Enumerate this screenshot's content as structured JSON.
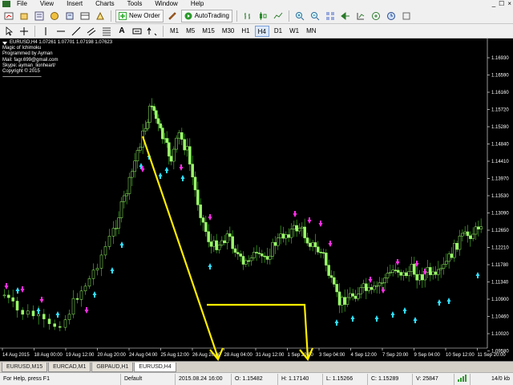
{
  "menu": {
    "items": [
      "File",
      "View",
      "Insert",
      "Charts",
      "Tools",
      "Window",
      "Help"
    ],
    "window_controls": [
      "_",
      "☐",
      "×"
    ]
  },
  "toolbar": {
    "new_order_label": "New Order",
    "autotrading_label": "AutoTrading",
    "timeframes": [
      "M1",
      "M5",
      "M15",
      "M30",
      "H1",
      "H4",
      "D1",
      "W1",
      "MN"
    ],
    "active_timeframe": "H4"
  },
  "chart": {
    "header": {
      "symbol_line": "EURUSD,H4  1.07261 1.07701 1.07198 1.07623",
      "lines": [
        "Magic of Ichimoku",
        "Programmed by  Ayman",
        "Mail: fagr.699@gmail.com",
        "Skype: ayman_lionheart/",
        "Copyright © 2015"
      ],
      "divider": "------------------------------------------------"
    },
    "colors": {
      "background": "#000000",
      "candle": "#9bff6a",
      "wick": "#4dcc2a",
      "buy_arrow": "#30e0ff",
      "sell_arrow": "#ff2ee8",
      "annotation": "#ffee00",
      "grid_text": "#ffffff"
    }
  },
  "chart_data": {
    "type": "candlestick",
    "symbol": "EURUSD",
    "timeframe": "H4",
    "y_ticks": [
      "1.16930",
      "1.16590",
      "1.16160",
      "1.15720",
      "1.15280",
      "1.14840",
      "1.14410",
      "1.13970",
      "1.13530",
      "1.13090",
      "1.12650",
      "1.12210",
      "1.11780",
      "1.11340",
      "1.10900",
      "1.10460",
      "1.10020",
      "1.09580"
    ],
    "x_ticks": [
      "14 Aug 2015",
      "18 Aug 00:00",
      "19 Aug 12:00",
      "20 Aug 20:00",
      "24 Aug 04:00",
      "25 Aug 12:00",
      "26 Aug 20:00",
      "28 Aug 04:00",
      "31 Aug 12:00",
      "1 Sep 20:00",
      "3 Sep 04:00",
      "4 Sep 12:00",
      "7 Sep 20:00",
      "9 Sep 04:00",
      "10 Sep 12:00",
      "11 Sep 20:00"
    ],
    "ylim": [
      1.0958,
      1.1693
    ]
  },
  "tabs": [
    {
      "label": "EURUSD,M15",
      "active": false
    },
    {
      "label": "EURCAD,M1",
      "active": false
    },
    {
      "label": "GBPAUD,H1",
      "active": false
    },
    {
      "label": "EURUSD,H4",
      "active": true
    }
  ],
  "status": {
    "help": "For Help, press F1",
    "profile": "Default",
    "datetime": "2015.08.24 16:00",
    "open": "O: 1.15482",
    "high": "H: 1.17140",
    "low": "L: 1.15266",
    "close": "C: 1.15289",
    "volume": "V: 25847",
    "traffic": "14/0 kb"
  }
}
